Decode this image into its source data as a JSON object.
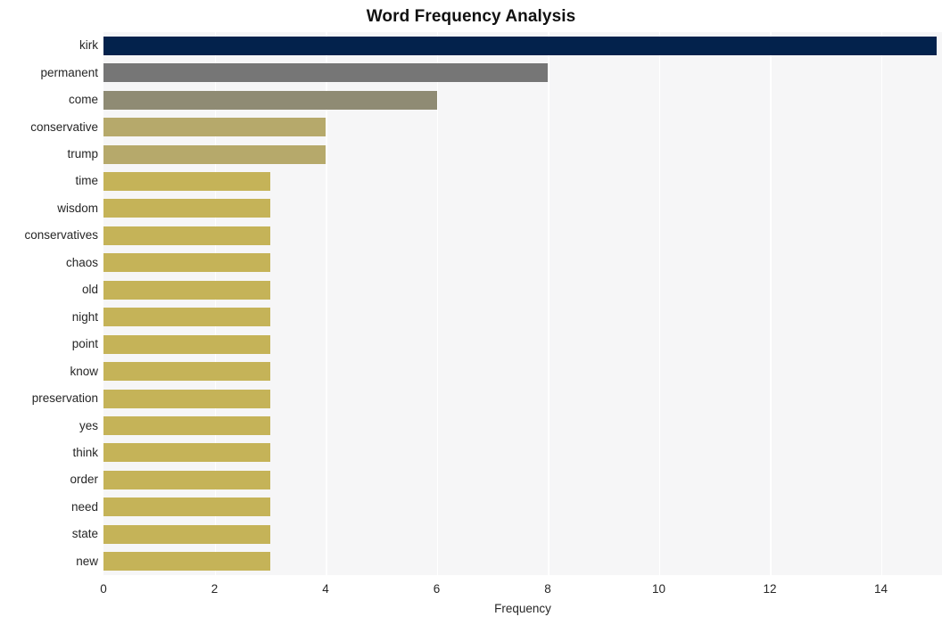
{
  "chart_data": {
    "type": "bar",
    "orientation": "horizontal",
    "title": "Word Frequency Analysis",
    "xlabel": "Frequency",
    "ylabel": "",
    "xlim": [
      0,
      15.1
    ],
    "ylim": null,
    "grid": true,
    "legend": null,
    "legend_position": "none",
    "x_ticks": [
      0,
      2,
      4,
      6,
      8,
      10,
      12,
      14
    ],
    "x_tick_labels": [
      "0",
      "2",
      "4",
      "6",
      "8",
      "10",
      "12",
      "14"
    ],
    "categories": [
      "kirk",
      "permanent",
      "come",
      "conservative",
      "trump",
      "time",
      "wisdom",
      "conservatives",
      "chaos",
      "old",
      "night",
      "point",
      "know",
      "preservation",
      "yes",
      "think",
      "order",
      "need",
      "state",
      "new"
    ],
    "values": [
      15,
      8,
      6,
      4,
      4,
      3,
      3,
      3,
      3,
      3,
      3,
      3,
      3,
      3,
      3,
      3,
      3,
      3,
      3,
      3
    ],
    "bar_colors": [
      "#03224c",
      "#767676",
      "#8f8b74",
      "#b6a96b",
      "#b6a96b",
      "#c5b358",
      "#c5b358",
      "#c5b358",
      "#c5b358",
      "#c5b358",
      "#c5b358",
      "#c5b358",
      "#c5b358",
      "#c5b358",
      "#c5b358",
      "#c5b358",
      "#c5b358",
      "#c5b358",
      "#c5b358",
      "#c5b358"
    ],
    "plot_background": "#f6f6f7",
    "gridline_color": "#ffffff",
    "figure_background": "#ffffff",
    "text_color": "#262626"
  }
}
